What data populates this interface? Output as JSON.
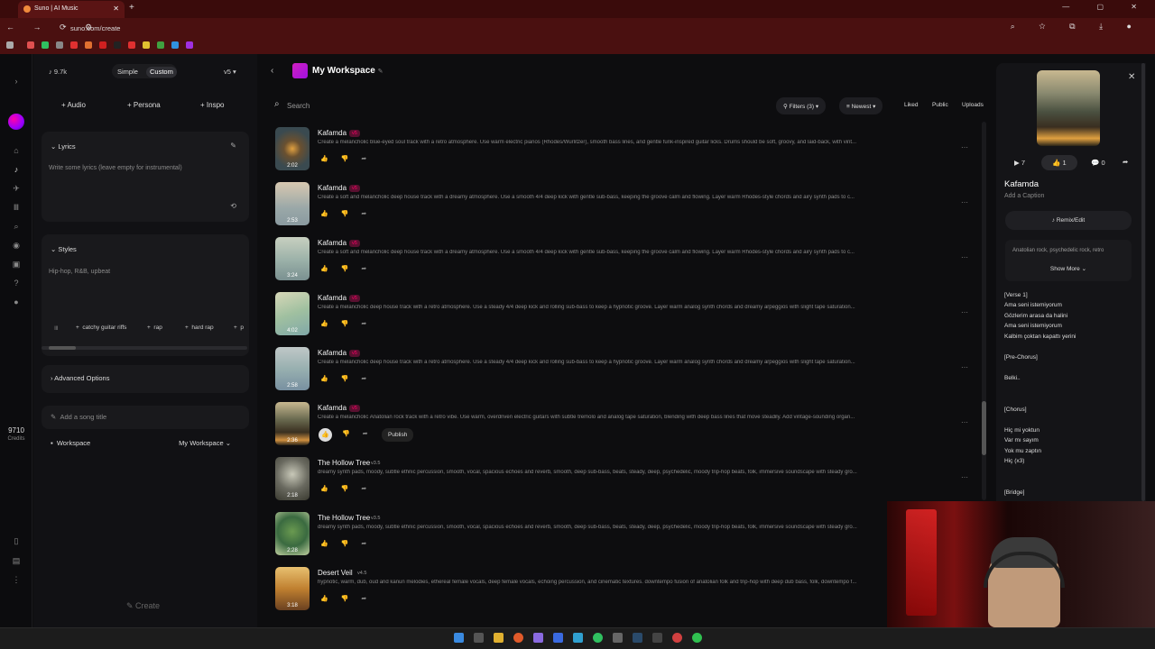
{
  "browser": {
    "tab_title": "Suno | AI Music",
    "tab_close": "✕",
    "new_tab": "+",
    "url": "suno.com/create",
    "nav_glyphs": "← → ⟳ ⚙",
    "addr_glyphs": "⌕ ☆ ⧉ ⤓ ●",
    "win_glyphs": "— ▢ ✕"
  },
  "rail": {
    "credits": "9710",
    "credits_label": "Credits"
  },
  "create": {
    "count": "9.7k",
    "mode_simple": "Simple",
    "mode_custom": "Custom",
    "version": "v5",
    "audio_label": "Audio",
    "persona_label": "Persona",
    "inspo_label": "Inspo",
    "lyrics_title": "Lyrics",
    "lyrics_placeholder": "Write some lyrics (leave empty for instrumental)",
    "styles_title": "Styles",
    "styles_placeholder": "Hip-hop, R&B, upbeat",
    "chips": [
      "catchy guitar riffs",
      "rap",
      "hard rap",
      "p"
    ],
    "advanced_label": "Advanced Options",
    "song_title_placeholder": "Add a song title",
    "workspace_label": "Workspace",
    "workspace_value": "My Workspace",
    "create_label": "Create"
  },
  "workspace": {
    "title": "My Workspace",
    "search_placeholder": "Search",
    "filters_label": "Filters (3)",
    "sort_label": "Newest",
    "liked_label": "Liked",
    "public_label": "Public",
    "uploads_label": "Uploads",
    "publish_label": "Publish"
  },
  "songs": [
    {
      "title": "Kafamda",
      "version": "v5",
      "duration": "2:02",
      "desc": "Create a melancholic blue-eyed soul track with a retro atmosphere. Use warm electric pianos (Rhodes/Wurlitzer), smooth bass lines, and gentle funk-inspired guitar licks. Drums should be soft, groovy, and laid-back, with vint..."
    },
    {
      "title": "Kafamda",
      "version": "v5",
      "duration": "2:53",
      "desc": "Create a soft and melancholic deep house track with a dreamy atmosphere. Use a smooth 4/4 deep kick with gentle sub-bass, keeping the groove calm and flowing. Layer warm Rhodes-style chords and airy synth pads to c..."
    },
    {
      "title": "Kafamda",
      "version": "v5",
      "duration": "3:24",
      "desc": "Create a soft and melancholic deep house track with a dreamy atmosphere. Use a smooth 4/4 deep kick with gentle sub-bass, keeping the groove calm and flowing. Layer warm Rhodes-style chords and airy synth pads to c..."
    },
    {
      "title": "Kafamda",
      "version": "v5",
      "duration": "4:02",
      "desc": "Create a melancholic deep house track with a retro atmosphere. Use a steady 4/4 deep kick and rolling sub-bass to keep a hypnotic groove. Layer warm analog synth chords and dreamy arpeggios with slight tape saturation..."
    },
    {
      "title": "Kafamda",
      "version": "v5",
      "duration": "2:58",
      "desc": "Create a melancholic deep house track with a retro atmosphere. Use a steady 4/4 deep kick and rolling sub-bass to keep a hypnotic groove. Layer warm analog synth chords and dreamy arpeggios with slight tape saturation..."
    },
    {
      "title": "Kafamda",
      "version": "v5",
      "duration": "2:36",
      "desc": "Create a melancholic Anatolian rock track with a retro vibe. Use warm, overdriven electric guitars with subtle tremolo and analog tape saturation, blending with deep bass lines that move steadily. Add vintage-sounding organ..."
    },
    {
      "title": "The Hollow Tree",
      "version": "v3.5",
      "duration": "2:18",
      "desc": "dreamy synth pads, moody, subtle ethnic percussion, smooth, vocal, spacious echoes and reverb, smooth, deep sub-bass, beats, steady, deep, psychedelic, moody trip-hop beats, folk, immersive soundscape with steady gro..."
    },
    {
      "title": "The Hollow Tree",
      "version": "v3.5",
      "duration": "2:28",
      "desc": "dreamy synth pads, moody, subtle ethnic percussion, smooth, vocal, spacious echoes and reverb, smooth, deep sub-bass, beats, steady, deep, psychedelic, moody trip-hop beats, folk, immersive soundscape with steady gro..."
    },
    {
      "title": "Desert Veil",
      "version": "v4.5",
      "duration": "3:18",
      "desc": "hypnotic, warm, dub, oud and kanun melodies, ethereal female vocals, deep female vocals, echoing percussion, and cinematic textures. downtempo fusion of anatolian folk and trip-hop with deep dub bass, folk, downtempo f..."
    }
  ],
  "detail": {
    "plays": "7",
    "likes": "1",
    "comments": "0",
    "title": "Kafamda",
    "caption_placeholder": "Add a Caption",
    "remix_label": "Remix/Edit",
    "styles": "Anatolian rock, psychedelic rock, retro",
    "show_more": "Show More",
    "lyrics": [
      "[Verse 1]",
      "Ama seni istemiyorum",
      "Gözlerim arasa da halini",
      "Ama seni istemiyorum",
      "Kalbim çoktan kapattı yerini",
      "",
      "[Pre-Chorus]",
      "",
      "Belki..",
      "",
      "",
      "[Chorus]",
      "",
      "Hiç mi yoktun",
      "Var mı sayım",
      "Yok mu zaptın",
      "Hiç (x3)",
      "",
      "",
      "[Bridge]"
    ]
  },
  "colors": {
    "accent": "#d81b9c",
    "badge_v5": "#c4206b",
    "browser": "#4a1010"
  }
}
